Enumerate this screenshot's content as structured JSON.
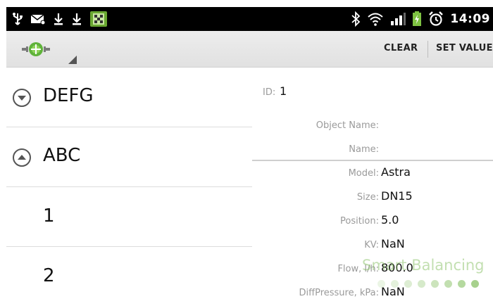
{
  "status_bar": {
    "time": "14:09",
    "left_icons": [
      "usb-icon",
      "mail-icon",
      "download-icon",
      "download-icon",
      "app-notification-icon"
    ],
    "right_icons": [
      "bluetooth-icon",
      "wifi-icon",
      "signal-icon",
      "battery-charging-icon",
      "alarm-icon"
    ]
  },
  "action_bar": {
    "logo": "app-logo-icon",
    "clear_label": "CLEAR",
    "set_value_label": "SET VALUE"
  },
  "list": {
    "items": [
      {
        "label": "DEFG",
        "type": "group",
        "expanded": false
      },
      {
        "label": "ABC",
        "type": "group",
        "expanded": true
      },
      {
        "label": "1",
        "type": "child"
      },
      {
        "label": "2",
        "type": "child"
      }
    ]
  },
  "detail": {
    "id_label": "ID:",
    "id_value": "1",
    "object_name_label": "Object Name:",
    "object_name_value": "",
    "name_label": "Name:",
    "name_value": "",
    "model_label": "Model:",
    "model_value": "Astra",
    "size_label": "Size:",
    "size_value": "DN15",
    "position_label": "Position:",
    "position_value": "5.0",
    "kv_label": "KV:",
    "kv_value": "NaN",
    "flow_label": "Flow, l/h:",
    "flow_value": "800.0",
    "diffpressure_label": "DiffPressure, kPa:",
    "diffpressure_value": "NaN"
  },
  "watermark": {
    "text": "Smart Balancing"
  },
  "colors": {
    "status_bar": "#000000",
    "battery": "#7ec242",
    "watermark": "#78b950"
  }
}
